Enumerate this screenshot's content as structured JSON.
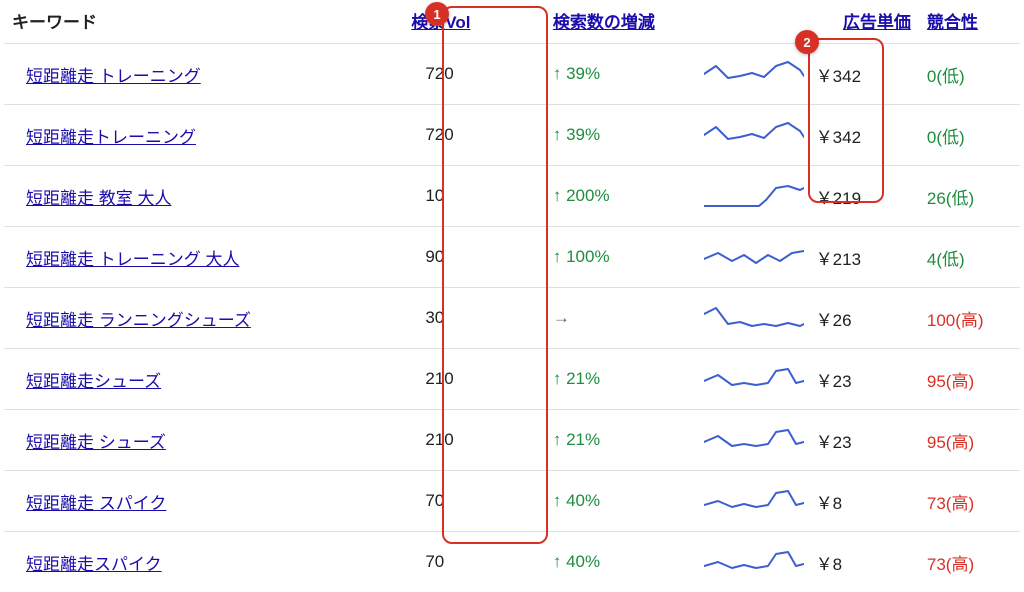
{
  "headers": {
    "keyword": "キーワード",
    "volume": "検索Vol",
    "trend": "検索数の増減",
    "cpc": "広告単価",
    "competition": "競合性"
  },
  "badges": {
    "b1": "1",
    "b2": "2"
  },
  "rows": [
    {
      "keyword": "短距離走 トレーニング",
      "volume": "720",
      "trend_dir": "up",
      "trend_text": "39%",
      "cpc": "￥342",
      "comp_text": "0(低)",
      "comp_class": "comp-low",
      "spark": "0,14 12,6 24,18 36,16 48,13 60,17 72,6 84,2 96,10 100,16"
    },
    {
      "keyword": "短距離走トレーニング",
      "volume": "720",
      "trend_dir": "up",
      "trend_text": "39%",
      "cpc": "￥342",
      "comp_text": "0(低)",
      "comp_class": "comp-low",
      "spark": "0,14 12,6 24,18 36,16 48,13 60,17 72,6 84,2 96,10 100,16"
    },
    {
      "keyword": "短距離走 教室 大人",
      "volume": "10",
      "trend_dir": "up",
      "trend_text": "200%",
      "cpc": "￥219",
      "comp_text": "26(低)",
      "comp_class": "comp-low",
      "spark": "0,24 20,24 40,24 55,24 62,18 72,6 84,4 96,8 100,6"
    },
    {
      "keyword": "短距離走 トレーニング 大人",
      "volume": "90",
      "trend_dir": "up",
      "trend_text": "100%",
      "cpc": "￥213",
      "comp_text": "4(低)",
      "comp_class": "comp-low",
      "spark": "0,16 14,10 28,18 40,12 52,20 64,12 76,18 88,10 100,8"
    },
    {
      "keyword": "短距離走 ランニングシューズ",
      "volume": "30",
      "trend_dir": "flat",
      "trend_text": "",
      "cpc": "￥26",
      "comp_text": "100(高)",
      "comp_class": "comp-high",
      "spark": "0,10 12,4 24,20 36,18 48,22 60,20 72,22 84,19 96,22 100,20"
    },
    {
      "keyword": "短距離走シューズ",
      "volume": "210",
      "trend_dir": "up",
      "trend_text": "21%",
      "cpc": "￥23",
      "comp_text": "95(高)",
      "comp_class": "comp-high",
      "spark": "0,16 14,10 28,20 40,18 52,20 64,18 72,6 84,4 92,18 100,16"
    },
    {
      "keyword": "短距離走 シューズ",
      "volume": "210",
      "trend_dir": "up",
      "trend_text": "21%",
      "cpc": "￥23",
      "comp_text": "95(高)",
      "comp_class": "comp-high",
      "spark": "0,16 14,10 28,20 40,18 52,20 64,18 72,6 84,4 92,18 100,16"
    },
    {
      "keyword": "短距離走 スパイク",
      "volume": "70",
      "trend_dir": "up",
      "trend_text": "40%",
      "cpc": "￥8",
      "comp_text": "73(高)",
      "comp_class": "comp-high",
      "spark": "0,18 14,14 28,20 40,17 52,20 64,18 72,6 84,4 92,18 100,16"
    },
    {
      "keyword": "短距離走スパイク",
      "volume": "70",
      "trend_dir": "up",
      "trend_text": "40%",
      "cpc": "￥8",
      "comp_text": "73(高)",
      "comp_class": "comp-high",
      "spark": "0,18 14,14 28,20 40,17 52,20 64,18 72,6 84,4 92,18 100,16"
    }
  ]
}
